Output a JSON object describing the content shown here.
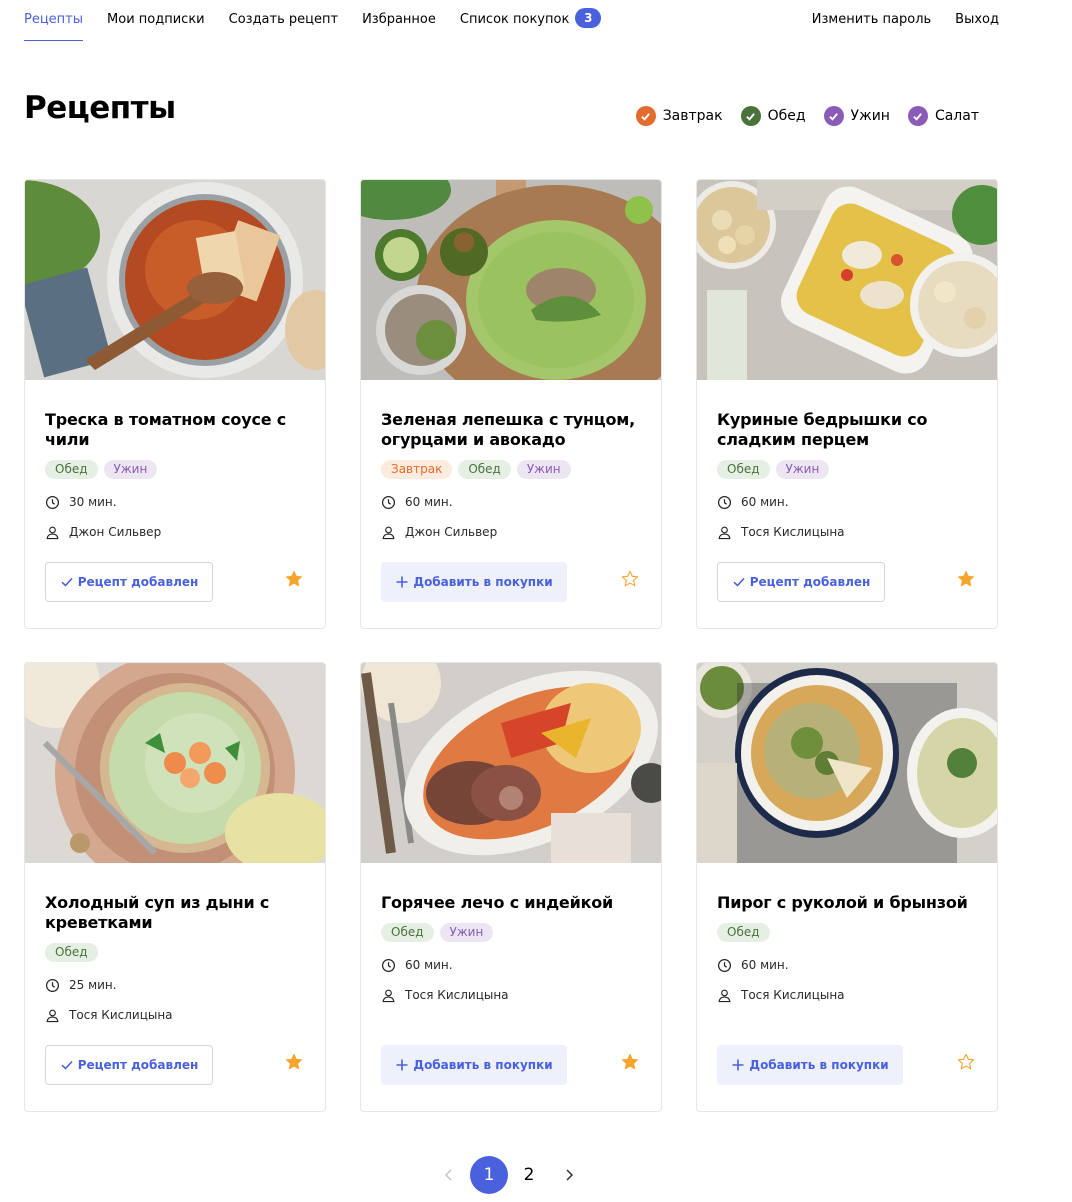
{
  "nav": {
    "items": [
      {
        "label": "Рецепты",
        "active": true
      },
      {
        "label": "Мои подписки"
      },
      {
        "label": "Создать рецепт"
      },
      {
        "label": "Избранное"
      },
      {
        "label": "Список покупок",
        "badge": "3"
      }
    ],
    "right": [
      {
        "label": "Изменить пароль"
      },
      {
        "label": "Выход"
      }
    ]
  },
  "page_title": "Рецепты",
  "filters": [
    {
      "label": "Завтрак",
      "color": "#e26c2d"
    },
    {
      "label": "Обед",
      "color": "#49733b"
    },
    {
      "label": "Ужин",
      "color": "#8a5bb7"
    },
    {
      "label": "Салат",
      "color": "#8a5bb7"
    }
  ],
  "recipes": [
    {
      "title": "Треска в томатном соусе с чили",
      "tags": [
        "Обед",
        "Ужин"
      ],
      "time": "30 мин.",
      "author": "Джон Сильвер",
      "button": "Рецепт добавлен",
      "favorited": true
    },
    {
      "title": "Зеленая лепешка с тунцом, огурцами и авокадо",
      "tags": [
        "Завтрак",
        "Обед",
        "Ужин"
      ],
      "time": "60 мин.",
      "author": "Джон Сильвер",
      "button": "Добавить в покупки",
      "favorited": false
    },
    {
      "title": "Куриные бедрышки со сладким перцем",
      "tags": [
        "Обед",
        "Ужин"
      ],
      "time": "60 мин.",
      "author": "Тося Кислицына",
      "button": "Рецепт добавлен",
      "favorited": true
    },
    {
      "title": "Холодный суп из дыни с креветками",
      "tags": [
        "Обед"
      ],
      "time": "25 мин.",
      "author": "Тося Кислицына",
      "button": "Рецепт добавлен",
      "favorited": true
    },
    {
      "title": "Горячее лечо с индейкой",
      "tags": [
        "Обед",
        "Ужин"
      ],
      "time": "60 мин.",
      "author": "Тося Кислицына",
      "button": "Добавить в покупки",
      "favorited": true
    },
    {
      "title": "Пирог с руколой и брынзой",
      "tags": [
        "Обед"
      ],
      "time": "60 мин.",
      "author": "Тося Кислицына",
      "button": "Добавить в покупки",
      "favorited": false
    }
  ],
  "pagination": {
    "pages": [
      "1",
      "2"
    ],
    "current": "1"
  }
}
